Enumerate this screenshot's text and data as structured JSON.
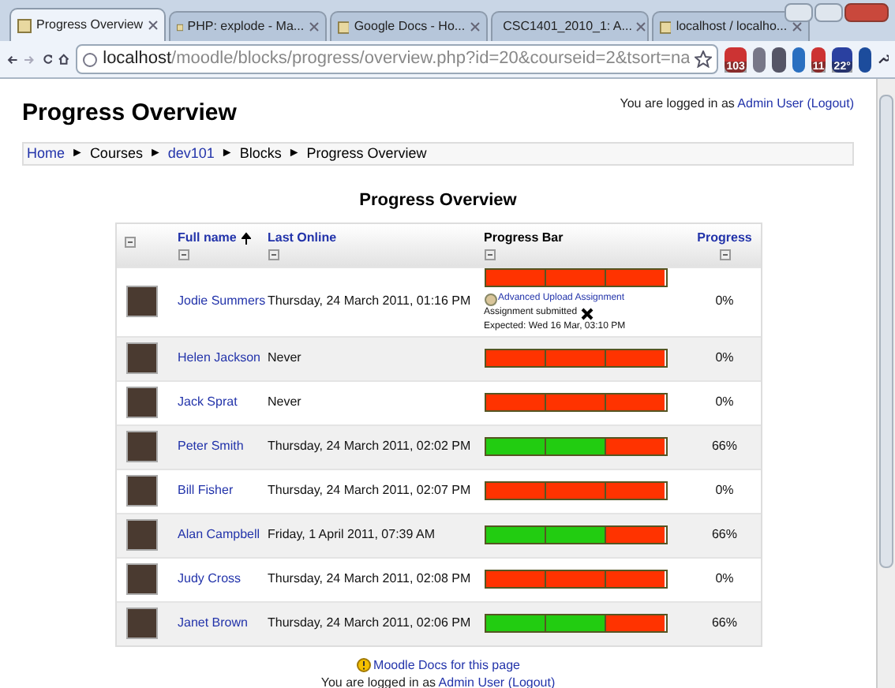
{
  "browser": {
    "tabs": [
      {
        "label": "Progress Overview",
        "selected": true
      },
      {
        "label": "PHP: explode - Ma...",
        "selected": false
      },
      {
        "label": "Google Docs - Ho...",
        "selected": false
      },
      {
        "label": "CSC1401_2010_1: A...",
        "selected": false
      },
      {
        "label": "localhost / localho...",
        "selected": false
      }
    ],
    "url_host": "localhost",
    "url_path": "/moodle/blocks/progress/overview.php?id=20&courseid=2&tsort=na",
    "badges": [
      "103",
      "11",
      "22°"
    ]
  },
  "page": {
    "title": "Progress Overview",
    "login_prefix": "You are logged in as",
    "login_user": "Admin User",
    "login_logout": "(Logout)",
    "breadcrumb": [
      {
        "label": "Home",
        "link": true
      },
      {
        "label": "Courses",
        "link": false
      },
      {
        "label": "dev101",
        "link": true
      },
      {
        "label": "Blocks",
        "link": false
      },
      {
        "label": "Progress Overview",
        "link": false
      }
    ],
    "breadcrumb_separator": "►"
  },
  "table": {
    "title": "Progress Overview",
    "columns": [
      {
        "label": "Full name",
        "link": true,
        "sorted": true
      },
      {
        "label": "Last Online",
        "link": true,
        "sorted": false
      },
      {
        "label": "Progress Bar",
        "link": false,
        "sorted": false
      },
      {
        "label": "Progress",
        "link": true,
        "sorted": false
      }
    ],
    "rows": [
      {
        "name": "Jodie Summers",
        "last_online": "Thursday, 24 March 2011, 01:16 PM",
        "segments": [
          {
            "done": false
          },
          {
            "done": false
          },
          {
            "done": false
          }
        ],
        "progress": "0%",
        "info": {
          "link": "Advanced Upload Assignment",
          "status": "Assignment submitted",
          "expected": "Expected: Wed 16 Mar, 03:10 PM"
        }
      },
      {
        "name": "Helen Jackson",
        "last_online": "Never",
        "segments": [
          {
            "done": false
          },
          {
            "done": false
          },
          {
            "done": false
          }
        ],
        "progress": "0%"
      },
      {
        "name": "Jack Sprat",
        "last_online": "Never",
        "segments": [
          {
            "done": false
          },
          {
            "done": false
          },
          {
            "done": false
          }
        ],
        "progress": "0%"
      },
      {
        "name": "Peter Smith",
        "last_online": "Thursday, 24 March 2011, 02:02 PM",
        "segments": [
          {
            "done": true
          },
          {
            "done": true
          },
          {
            "done": false
          }
        ],
        "progress": "66%"
      },
      {
        "name": "Bill Fisher",
        "last_online": "Thursday, 24 March 2011, 02:07 PM",
        "segments": [
          {
            "done": false
          },
          {
            "done": false
          },
          {
            "done": false
          }
        ],
        "progress": "0%"
      },
      {
        "name": "Alan Campbell",
        "last_online": "Friday, 1 April 2011, 07:39 AM",
        "segments": [
          {
            "done": true
          },
          {
            "done": true
          },
          {
            "done": false
          }
        ],
        "progress": "66%"
      },
      {
        "name": "Judy Cross",
        "last_online": "Thursday, 24 March 2011, 02:08 PM",
        "segments": [
          {
            "done": false
          },
          {
            "done": false
          },
          {
            "done": false
          }
        ],
        "progress": "0%"
      },
      {
        "name": "Janet Brown",
        "last_online": "Thursday, 24 March 2011, 02:06 PM",
        "segments": [
          {
            "done": true
          },
          {
            "done": true
          },
          {
            "done": false
          }
        ],
        "progress": "66%"
      }
    ]
  },
  "footer": {
    "docs_link": "Moodle Docs for this page",
    "login_prefix": "You are logged in as",
    "login_user": "Admin User",
    "login_logout": "(Logout)"
  }
}
